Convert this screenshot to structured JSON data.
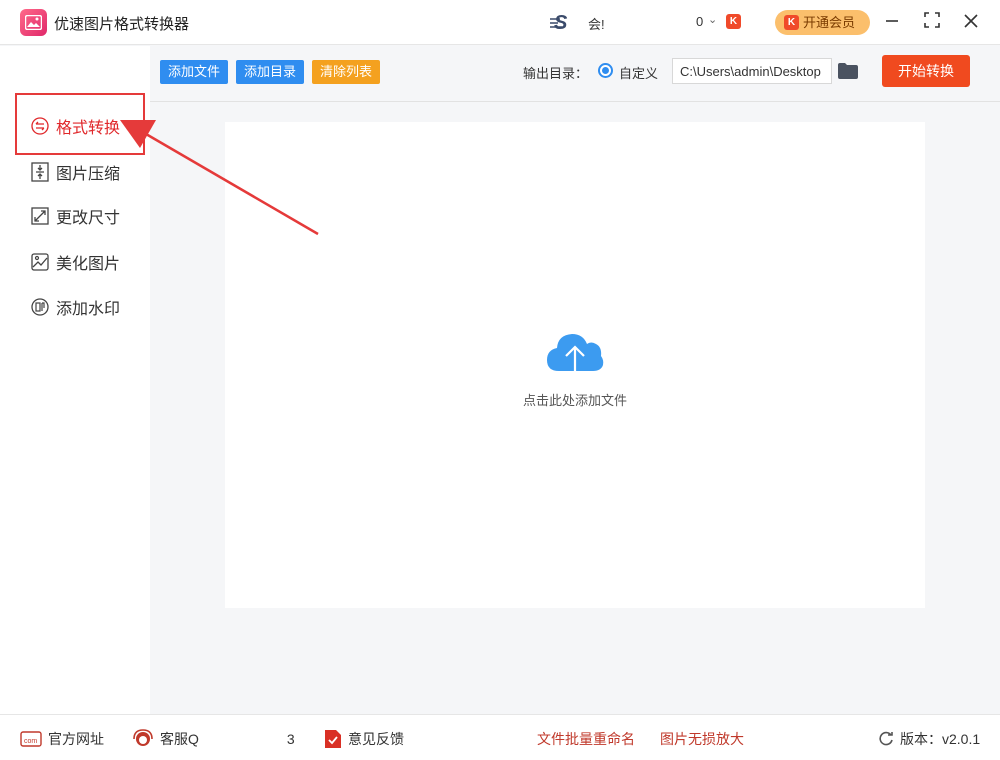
{
  "app": {
    "title": "优速图片格式转换器"
  },
  "header": {
    "user_name": "会!",
    "coin_count": "0",
    "coin_icon_letter": "K",
    "vip_label": "开通会员"
  },
  "sidebar": {
    "items": [
      {
        "label": "格式转换",
        "icon": "convert-icon",
        "active": true
      },
      {
        "label": "图片压缩",
        "icon": "compress-icon"
      },
      {
        "label": "更改尺寸",
        "icon": "resize-icon"
      },
      {
        "label": "美化图片",
        "icon": "beautify-icon"
      },
      {
        "label": "添加水印",
        "icon": "watermark-icon"
      }
    ]
  },
  "toolbar": {
    "add_file": "添加文件",
    "add_folder": "添加目录",
    "clear_list": "清除列表",
    "output_label": "输出目录：",
    "custom_option": "自定义",
    "output_path": "C:\\Users\\admin\\Desktop",
    "start": "开始转换"
  },
  "main": {
    "drop_hint": "点击此处添加文件"
  },
  "footer": {
    "website": "官方网址",
    "service_prefix": "客服Q",
    "service_suffix": "3",
    "feedback": "意见反馈",
    "batch_rename": "文件批量重命名",
    "lossless_enlarge": "图片无损放大",
    "version_label": "版本：",
    "version": "v2.0.1"
  },
  "colors": {
    "accent_blue": "#2f8df0",
    "accent_orange": "#f4a11f",
    "start_red": "#f04a1f",
    "active_red": "#e0282b"
  }
}
